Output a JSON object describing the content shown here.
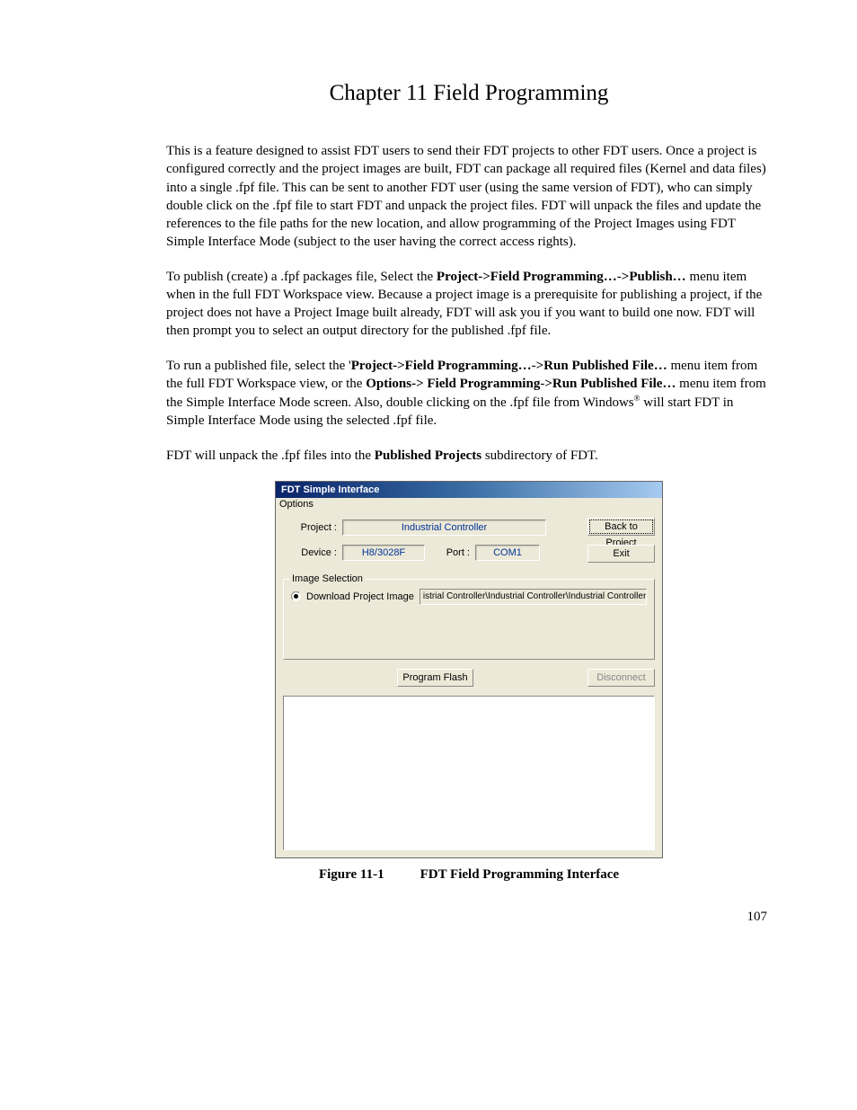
{
  "chapter_title": "Chapter 11   Field Programming",
  "para1": "This is a feature designed to assist FDT users to send their FDT projects to other FDT users. Once a project is configured correctly and the project images are built, FDT can package all required files (Kernel and data files) into a single .fpf file. This can be sent to another FDT user (using the same version of FDT), who can simply double click on the .fpf file to start FDT and unpack the project files. FDT will unpack the files and update the references to the file paths for the new location, and allow programming of the Project Images using FDT Simple Interface Mode (subject to the user having the correct access rights).",
  "para2": {
    "lead": "To publish (create) a .fpf packages file, Select the ",
    "bold1": "Project->Field Programming…",
    "arrow1": "-",
    "bold2": ">Publish…",
    "tail": " menu item when in the full FDT Workspace view. Because a project image is a prerequisite for publishing a project, if the project does not have a Project Image built already, FDT will ask you if you want to build one now. FDT will then prompt you to select an output directory for the published .fpf file."
  },
  "para3": {
    "lead": "To run a published file, select the '",
    "bold1": "Project->Field Programming…",
    "arrow1": "-",
    "bold2": ">Run Published File…",
    "mid1": " menu item from the full FDT Workspace view, or the ",
    "bold3": "Options-> Field Programming",
    "arrow2": "-",
    "bold4": ">Run Published File…",
    "mid2": " menu item from the Simple Interface Mode screen. Also, double clicking on the .fpf file from Windows",
    "reg": "®",
    "tail": " will start FDT in Simple Interface Mode using the selected .fpf file."
  },
  "para4": {
    "lead": "FDT will unpack the .fpf files into the ",
    "bold": "Published Projects",
    "tail": " subdirectory of FDT."
  },
  "fdt": {
    "title": "FDT Simple Interface",
    "menu_options": "Options",
    "labels": {
      "project": "Project :",
      "device": "Device :",
      "port": "Port :",
      "image_selection": "Image Selection",
      "download_project_image": "Download Project Image"
    },
    "values": {
      "project": "Industrial Controller",
      "device": "H8/3028F",
      "port": "COM1",
      "filepath": "istrial Controller\\Industrial Controller\\Industrial Controller.ddi"
    },
    "buttons": {
      "back_to_project": "Back to Project",
      "exit": "Exit",
      "program_flash": "Program Flash",
      "disconnect": "Disconnect"
    }
  },
  "figure": {
    "label": "Figure 11-1",
    "caption": "FDT Field Programming Interface"
  },
  "page_number": "107"
}
